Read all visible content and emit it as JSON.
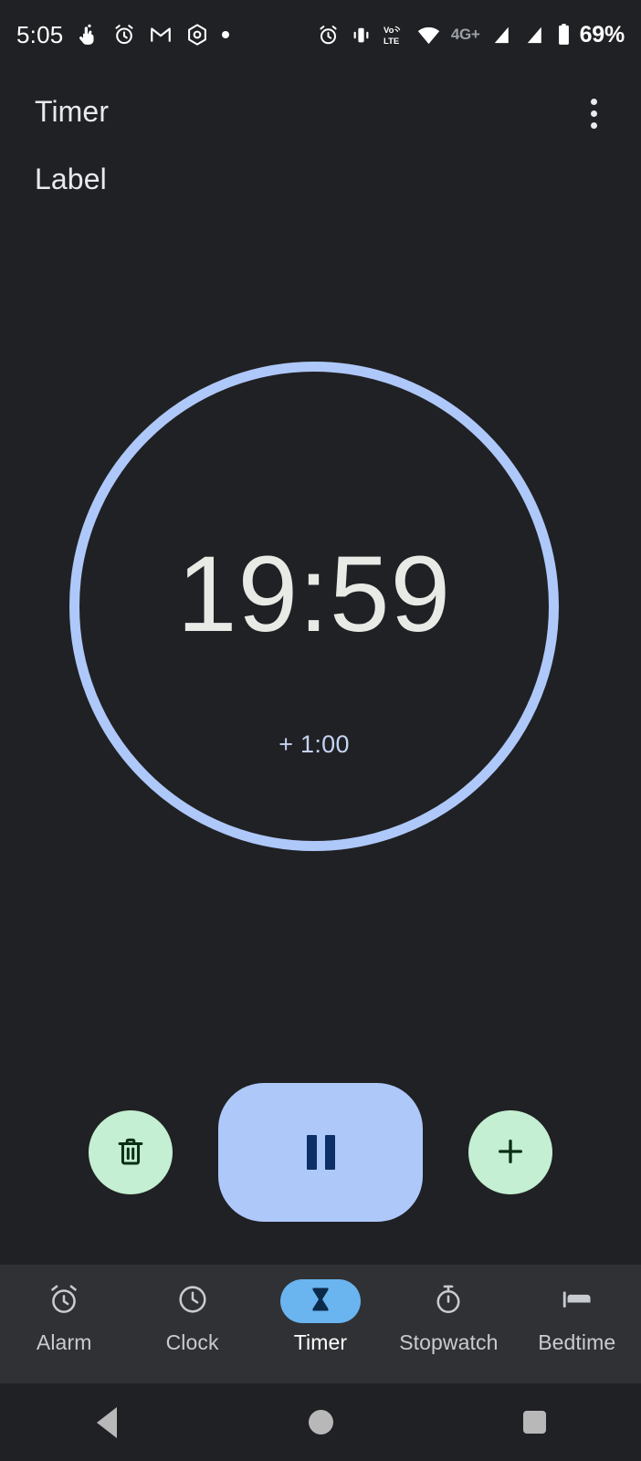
{
  "status_bar": {
    "clock": "5:05",
    "left_icons": [
      "touch-indicator-icon",
      "alarm-icon",
      "gmail-icon",
      "photos-icon",
      "notification-dot"
    ],
    "right_icons": [
      "alarm-icon",
      "vibrate-icon",
      "volte-icon",
      "wifi-icon",
      "signal-bar-icon",
      "signal-bar-icon",
      "battery-icon"
    ],
    "network_label": "4G+",
    "battery_percent": "69%"
  },
  "app_bar": {
    "title": "Timer",
    "overflow_menu": "more-options"
  },
  "timer": {
    "label": "Label",
    "remaining": "19:59",
    "add_minute_hint": "+ 1:00",
    "ring_color": "#aec8fa",
    "time_color": "#e8eae6",
    "hint_color": "#c5d4f5"
  },
  "actions": {
    "delete_label": "Delete timer",
    "delete_icon": "trash-icon",
    "primary_label": "Pause",
    "primary_icon": "pause-icon",
    "add_label": "Add one minute",
    "add_icon": "plus-icon",
    "accent_green": "#c4efd2",
    "accent_blue": "#aec8fa",
    "pause_glyph_color": "#0d2f66",
    "green_glyph_color": "#0a2e14"
  },
  "bottom_nav": {
    "active_index": 2,
    "active_pill_color": "#6ab4f0",
    "items": [
      {
        "label": "Alarm",
        "icon": "alarm-clock-icon"
      },
      {
        "label": "Clock",
        "icon": "clock-icon"
      },
      {
        "label": "Timer",
        "icon": "hourglass-icon"
      },
      {
        "label": "Stopwatch",
        "icon": "stopwatch-icon"
      },
      {
        "label": "Bedtime",
        "icon": "bed-icon"
      }
    ]
  },
  "system_nav": {
    "back": "back-button",
    "home": "home-button",
    "recents": "recents-button"
  }
}
